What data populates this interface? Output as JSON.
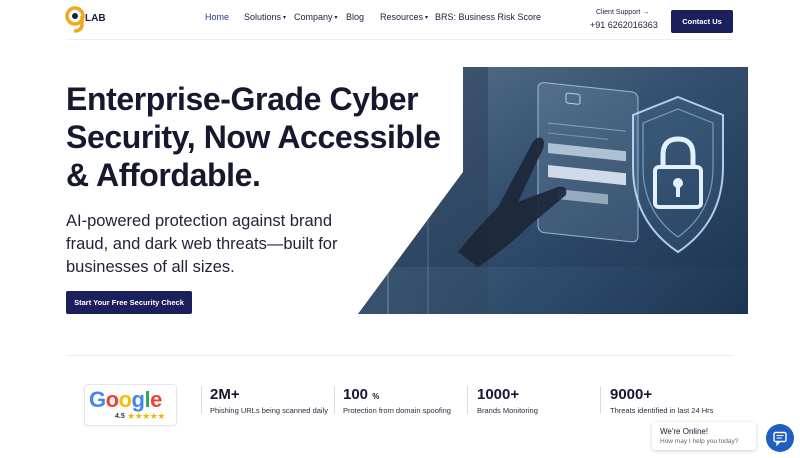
{
  "brand": {
    "logo_number": "9",
    "logo_text": "LAB"
  },
  "nav": {
    "items": [
      {
        "label": "Home",
        "has_caret": false
      },
      {
        "label": "Solutions",
        "has_caret": true
      },
      {
        "label": "Company",
        "has_caret": true
      },
      {
        "label": "Blog",
        "has_caret": false
      },
      {
        "label": "Resources",
        "has_caret": true
      },
      {
        "label": "BRS: Business Risk Score",
        "has_caret": false
      }
    ]
  },
  "support": {
    "label": "Client Support →",
    "phone": "+91 6262016363"
  },
  "header": {
    "contact_label": "Contact Us"
  },
  "hero": {
    "title": "Enterprise-Grade Cyber Security, Now Accessible & Affordable.",
    "subtitle": "AI-powered protection against brand fraud, and dark web threats—built for businesses of all sizes.",
    "cta_label": "Start Your Free Security Check"
  },
  "google": {
    "word": [
      "G",
      "o",
      "o",
      "g",
      "l",
      "e"
    ],
    "rating": "4.5",
    "stars": "★★★★★"
  },
  "stats": [
    {
      "value": "2M+",
      "suffix": "",
      "label": "Phishing URLs being scanned daily"
    },
    {
      "value": "100",
      "suffix": "%",
      "label": "Protection from domain spoofing"
    },
    {
      "value": "1000+",
      "suffix": "",
      "label": "Brands Monitoring"
    },
    {
      "value": "9000+",
      "suffix": "",
      "label": "Threats identified in last 24 Hrs"
    }
  ],
  "chat": {
    "title": "We're Online!",
    "subtitle": "How may I help you today?"
  },
  "colors": {
    "primary": "#1b1f5b",
    "accent": "#f0a81c",
    "chat": "#1f5fc0"
  }
}
